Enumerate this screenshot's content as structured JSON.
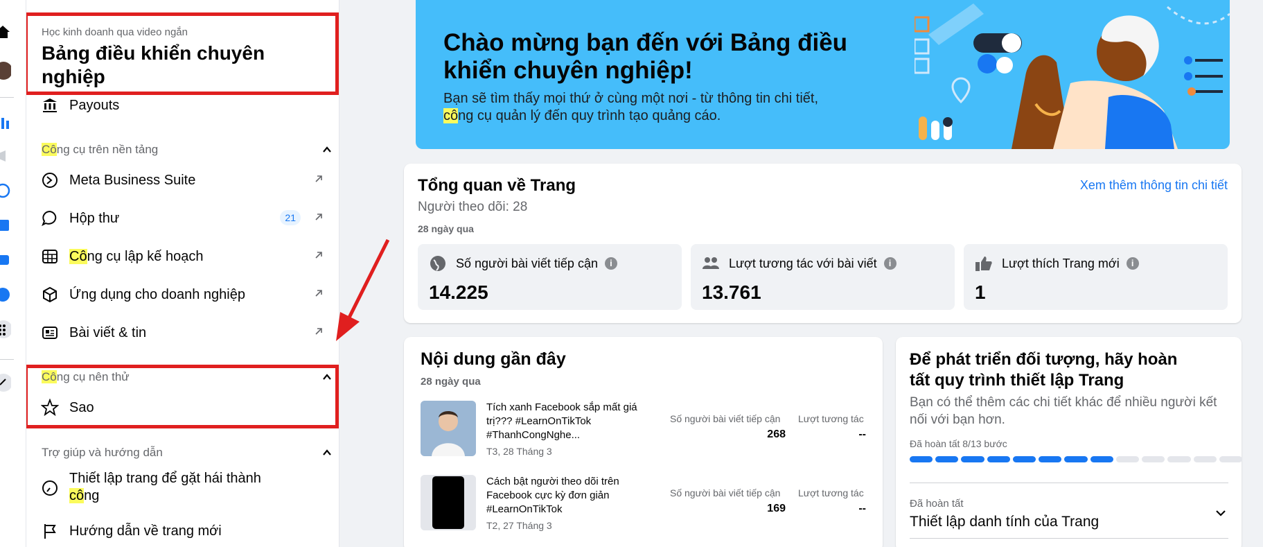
{
  "sidebar": {
    "subtitle": "Học kinh doanh qua video ngắn",
    "title": "Bảng điều khiển chuyên nghiệp",
    "payouts": "Payouts",
    "section_platform": {
      "hl": "Cô",
      "rest": "ng cụ trên nền tảng"
    },
    "items": [
      {
        "label": "Meta Business Suite"
      },
      {
        "label": "Hộp thư",
        "badge": "21"
      },
      {
        "hl": "Cô",
        "rest": "ng cụ lập kế hoạch"
      },
      {
        "label": "Ứng dụng cho doanh nghiệp"
      },
      {
        "label": "Bài viết & tin"
      }
    ],
    "section_try": {
      "hl": "Cô",
      "rest": "ng cụ nên thử"
    },
    "star": "Sao",
    "section_help": "Trợ giúp và hướng dẫn",
    "help_item1": {
      "line1": "Thiết lập trang để gặt hái thành",
      "hl": "cô",
      "rest": "ng"
    },
    "help_item2": "Hướng dẫn về trang mới"
  },
  "banner": {
    "title": "Chào mừng bạn đến với Bảng điều khiển chuyên nghiệp!",
    "desc1": "Bạn sẽ tìm thấy mọi thứ ở cùng một nơi - từ thông tin chi tiết,",
    "desc2_hl": "cô",
    "desc2_rest": "ng cụ quản lý đến quy trình tạo quảng cáo."
  },
  "overview": {
    "title": "Tổng quan về Trang",
    "followers": "Người theo dõi: 28",
    "period": "28 ngày qua",
    "link": "Xem thêm thông tin chi tiết",
    "metrics": [
      {
        "label": "Số người bài viết tiếp cận",
        "value": "14.225",
        "icon": "globe-icon"
      },
      {
        "label": "Lượt tương tác với bài viết",
        "value": "13.761",
        "icon": "people-icon"
      },
      {
        "label": "Lượt thích Trang mới",
        "value": "1",
        "icon": "thumbs-up-icon"
      }
    ]
  },
  "recent": {
    "title": "Nội dung gần đây",
    "period": "28 ngày qua",
    "col_reach": "Số người bài viết tiếp cận",
    "col_engage": "Lượt tương tác",
    "posts": [
      {
        "text": "Tích xanh Facebook sắp mất giá trị??? #LearnOnTikTok #ThanhCongNghe...",
        "date": "T3, 28 Tháng 3",
        "reach": "268",
        "engage": "--"
      },
      {
        "text": "Cách bật người theo dõi trên Facebook cực kỳ đơn giản #LearnOnTikTok",
        "date": "T2, 27 Tháng 3",
        "reach": "169",
        "engage": "--"
      }
    ]
  },
  "grow": {
    "title": "Để phát triển đối tượng, hãy hoàn tất quy trình thiết lập Trang",
    "desc": "Bạn có thể thêm các chi tiết khác để nhiều người kết nối với bạn hơn.",
    "progress": "Đã hoàn tất 8/13 bước",
    "done_label": "Đã hoàn tất",
    "step": "Thiết lập danh tính của Trang",
    "completed_steps": 8,
    "total_steps": 13
  },
  "colors": {
    "accent": "#1877f2",
    "banner": "#45bdfa",
    "highlight": "#fbfb5c",
    "annotation": "#e01f1f"
  }
}
